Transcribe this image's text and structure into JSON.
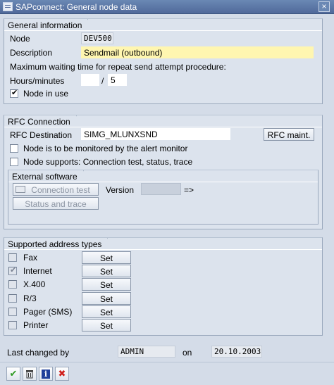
{
  "window": {
    "title": "SAPconnect: General node data",
    "close_glyph": "×"
  },
  "general": {
    "heading": "General information",
    "node_label": "Node",
    "node_value": "DEV500",
    "description_label": "Description",
    "description_value": "Sendmail (outbound)",
    "max_wait_text": "Maximum waiting time for repeat send attempt procedure:",
    "hours_label": "Hours/minutes",
    "hours_value": "",
    "separator": "/",
    "minutes_value": "5",
    "node_in_use_label": "Node in use",
    "node_in_use_checked": true
  },
  "rfc": {
    "heading": "RFC Connection",
    "destination_label": "RFC Destination",
    "destination_value": "SIMG_MLUNXSND",
    "maint_button": "RFC maint.",
    "monitored_label": "Node is to be monitored by the alert monitor",
    "supports_label": "Node supports: Connection test, status, trace",
    "external": {
      "heading": "External software",
      "connection_test_button": "Connection test",
      "version_label": "Version",
      "version_value": "",
      "arrow": "=>",
      "status_trace_button": "Status and trace"
    }
  },
  "address_types": {
    "heading": "Supported address types",
    "set_label": "Set",
    "items": [
      {
        "label": "Fax",
        "checked": false
      },
      {
        "label": "Internet",
        "checked": true
      },
      {
        "label": "X.400",
        "checked": false
      },
      {
        "label": "R/3",
        "checked": false
      },
      {
        "label": "Pager (SMS)",
        "checked": false
      },
      {
        "label": "Printer",
        "checked": false
      }
    ]
  },
  "footer": {
    "last_changed_label": "Last changed by",
    "user_value": "ADMIN",
    "on_label": "on",
    "date_value": "20.10.2003"
  },
  "toolbar": {
    "icons": [
      "checkmark-icon",
      "trash-icon",
      "info-icon",
      "cancel-icon"
    ]
  },
  "colors": {
    "accent_title": "#50699a",
    "required_field": "#fff6b0"
  }
}
